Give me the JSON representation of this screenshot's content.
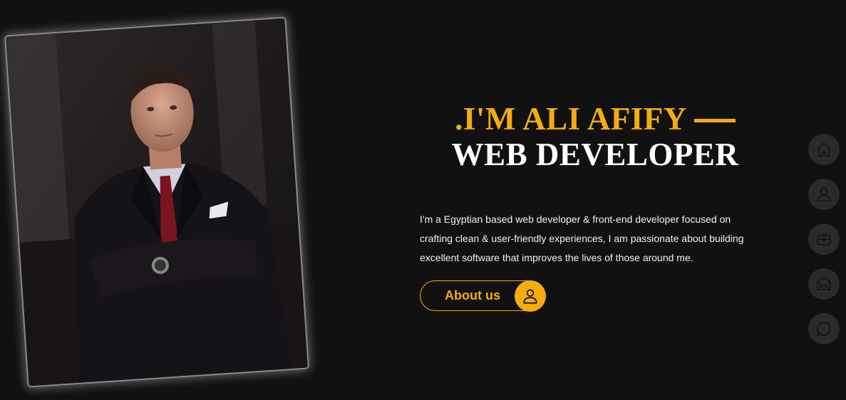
{
  "hero": {
    "greeting": ".I'M ALI AFIFY",
    "role": "WEB DEVELOPER",
    "intro": "I'm a Egyptian based web developer & front-end developer focused on crafting clean & user-friendly experiences, I am passionate about building excellent software that improves the lives of those around me.",
    "button_label": "About us",
    "button_icon": "user-icon"
  },
  "side_nav": {
    "items": [
      {
        "icon": "home-icon"
      },
      {
        "icon": "user-icon"
      },
      {
        "icon": "briefcase-icon"
      },
      {
        "icon": "mail-icon"
      },
      {
        "icon": "chat-icon"
      }
    ]
  },
  "colors": {
    "background": "#111111",
    "accent": "#f5ad0b",
    "text": "#ffffff",
    "nav_bg": "#2b2b2b"
  }
}
